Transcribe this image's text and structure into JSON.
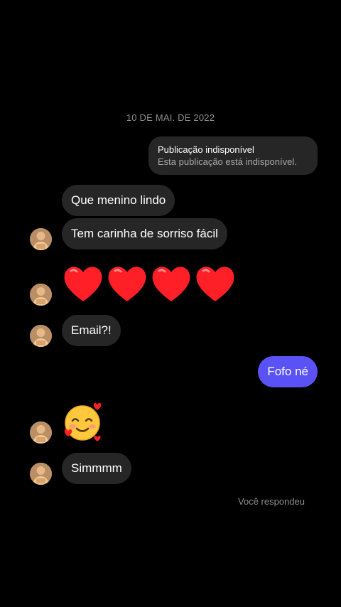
{
  "thread": {
    "date_divider": "10 DE MAI. DE 2022",
    "shared_post": {
      "title": "Publicação indisponível",
      "subtitle": "Esta publicação está indisponível."
    },
    "messages": [
      {
        "sender": "them",
        "text": "Que menino lindo"
      },
      {
        "sender": "them",
        "text": "Tem carinha de sorriso fácil"
      },
      {
        "sender": "them",
        "emoji": [
          "red-heart",
          "red-heart",
          "red-heart",
          "red-heart"
        ]
      },
      {
        "sender": "them",
        "text": "Email?!"
      },
      {
        "sender": "me",
        "text": "Fofo né"
      },
      {
        "sender": "them",
        "emoji": [
          "smiling-face-with-hearts"
        ]
      },
      {
        "sender": "them",
        "text": "Simmmm"
      }
    ],
    "status": "Você respondeu"
  },
  "colors": {
    "background": "#000000",
    "received_bubble": "#262626",
    "sent_bubble": "#5a52f5",
    "muted_text": "#8e8e93"
  }
}
